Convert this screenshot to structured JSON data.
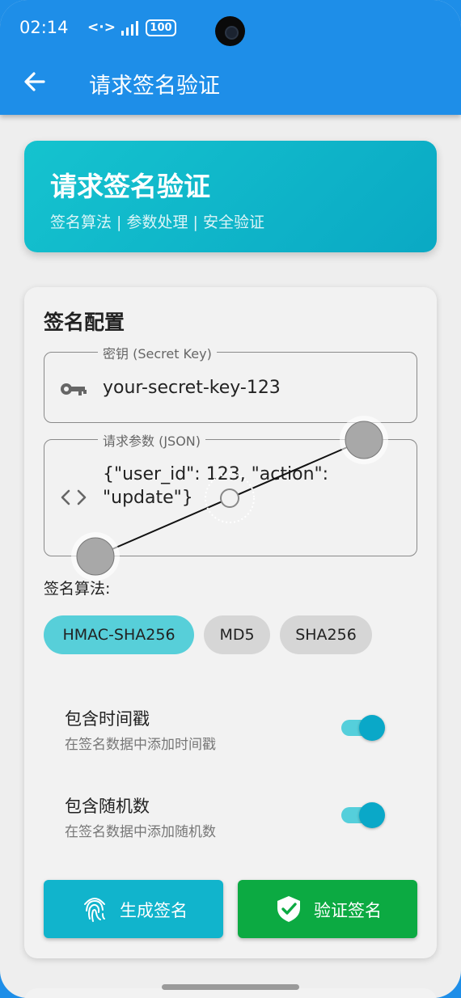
{
  "status_bar": {
    "time": "02:14",
    "network": "<·>",
    "battery": "100"
  },
  "app_bar": {
    "title": "请求签名验证",
    "back_icon": "arrow-back-icon"
  },
  "hero": {
    "title": "请求签名验证",
    "subtitle": "签名算法 | 参数处理 | 安全验证"
  },
  "config": {
    "title": "签名配置",
    "secret_key": {
      "label": "密钥 (Secret Key)",
      "value": "your-secret-key-123",
      "icon": "key-icon"
    },
    "params": {
      "label": "请求参数 (JSON)",
      "value": "{\"user_id\": 123, \"action\": \"update\"}",
      "icon": "code-icon"
    },
    "algorithm_label": "签名算法:",
    "algorithms": [
      "HMAC-SHA256",
      "MD5",
      "SHA256"
    ],
    "selected_algorithm": "HMAC-SHA256",
    "options": [
      {
        "title": "包含时间戳",
        "desc": "在签名数据中添加时间戳",
        "enabled": true
      },
      {
        "title": "包含随机数",
        "desc": "在签名数据中添加随机数",
        "enabled": true
      }
    ],
    "buttons": {
      "generate": {
        "label": "生成签名",
        "icon": "fingerprint-icon"
      },
      "verify": {
        "label": "验证签名",
        "icon": "shield-check-icon"
      }
    }
  },
  "colors": {
    "primary": "#1e8ee8",
    "accent": "#11b4cc",
    "chip_active": "#57cfd9",
    "verify": "#0caa42"
  }
}
